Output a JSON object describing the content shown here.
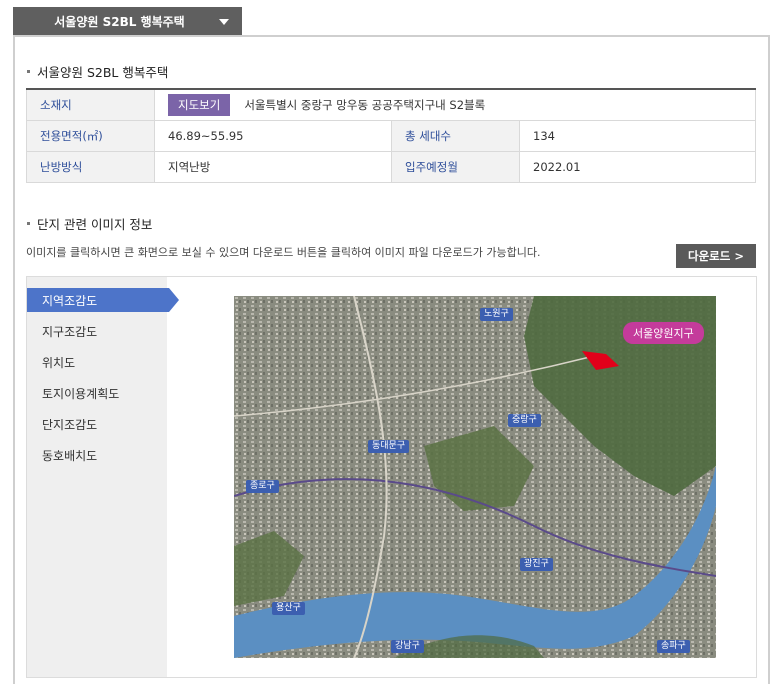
{
  "top_tab": {
    "label": "서울양원 S2BL 행복주택"
  },
  "section1": {
    "title": "서울양원 S2BL 행복주택"
  },
  "info": {
    "location_label": "소재지",
    "map_button": "지도보기",
    "location_value": "서울특별시 중랑구 망우동 공공주택지구내 S2블록",
    "area_label": "전용면적(㎡)",
    "area_value": "46.89~55.95",
    "units_label": "총 세대수",
    "units_value": "134",
    "heating_label": "난방방식",
    "heating_value": "지역난방",
    "move_in_label": "입주예정월",
    "move_in_value": "2022.01"
  },
  "section2": {
    "title": "단지 관련 이미지 정보",
    "description": "이미지를 클릭하시면 큰 화면으로 보실 수 있으며 다운로드 버튼을 클릭하여 이미지 파일 다운로드가 가능합니다.",
    "download_label": "다운로드 >"
  },
  "image_menu": [
    {
      "label": "지역조감도",
      "active": true
    },
    {
      "label": "지구조감도",
      "active": false
    },
    {
      "label": "위치도",
      "active": false
    },
    {
      "label": "토지이용계획도",
      "active": false
    },
    {
      "label": "단지조감도",
      "active": false
    },
    {
      "label": "동호배치도",
      "active": false
    }
  ],
  "map": {
    "callout": "서울양원지구",
    "district_labels": [
      "노원구",
      "중랑구",
      "동대문구",
      "종로구",
      "광진구",
      "용산구",
      "강남구",
      "송파구"
    ]
  },
  "colors": {
    "active_tab": "#4d74c9",
    "map_button": "#7b64a8",
    "callout": "#c43b9b"
  }
}
